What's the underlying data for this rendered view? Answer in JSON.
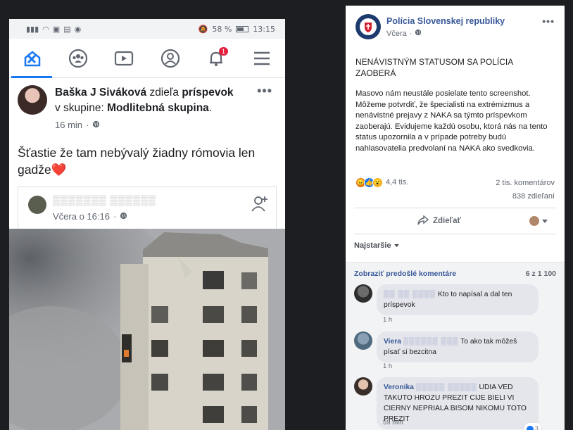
{
  "phone": {
    "status_bar": {
      "battery": "58 %",
      "time": "13:15"
    },
    "nav": {
      "items": [
        "home-icon",
        "groups-icon",
        "watch-icon",
        "profile-icon",
        "notifications-icon",
        "menu-icon"
      ],
      "notification_count": "1"
    },
    "post": {
      "author": "Baška J Siváková",
      "action_text": "zdieľa",
      "object_text": "príspevok",
      "group_prefix": "v skupine:",
      "group_name": "Modlitebná skupina",
      "time": "16 min",
      "text": "Šťastie že tam nebývalý žiadny rómovia len gadže❤️",
      "shared": {
        "name_redacted": "▒▒▒▒▒▒▒ ▒▒▒▒▒▒",
        "time": "Včera o 16:16"
      }
    }
  },
  "page_post": {
    "page_name": "Polícia Slovenskej republiky",
    "date": "Včera",
    "headline": "NENÁVISTNÝM STATUSOM SA POLÍCIA ZAOBERÁ",
    "body": "Masovo nám neustále posielate tento screenshot. Môžeme potvrdiť, že špecialisti na extrémizmus a nenávistné prejavy z NAKA sa týmto príspevkom zaoberajú. Evidujeme každú osobu, ktorá nás na tento status upozornila a v prípade potreby budú nahlasovatelia predvolaní na NAKA ako svedkovia.",
    "reactions_count": "4,4 tis.",
    "comments_count": "2 tis. komentárov",
    "shares_count": "838 zdieľaní",
    "share_label": "Zdieľať",
    "sort_label": "Najstaršie",
    "prev_comments_label": "Zobraziť predošlé komentáre",
    "prev_comments_count": "6 z 1 100",
    "comments": [
      {
        "name": "",
        "redacted": "▒▒ ▒▒ ▒▒▒▒",
        "text": "Kto to napísal a dal ten príspevok",
        "time": "1 h",
        "likes": ""
      },
      {
        "name": "Viera",
        "redacted": "▒▒▒▒▒▒ ▒▒▒",
        "text": "To ako tak môžeš písať si bezcitna",
        "time": "1 h",
        "likes": ""
      },
      {
        "name": "Veronika",
        "redacted": "▒▒▒▒▒ ▒▒▒▒▒",
        "text": "UDIA VED TAKUTO HROZU PREZIT CIJE BIELI VI CIERNY NEPRIALA BISOM NIKOMU TOTO PREZIT",
        "time": "59 min",
        "likes": "3"
      }
    ]
  }
}
